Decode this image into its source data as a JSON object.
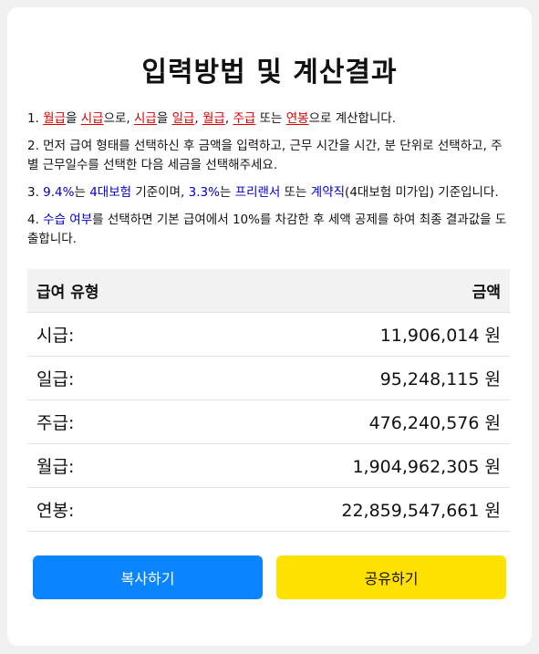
{
  "title": "입력방법 및 계산결과",
  "instructions": {
    "line1": {
      "num": "1. ",
      "t1": "월급",
      "s1": "을 ",
      "t2": "시급",
      "s2": "으로, ",
      "t3": "시급",
      "s3": "을 ",
      "t4": "일급",
      "s4": ", ",
      "t5": "월급",
      "s5": ", ",
      "t6": "주급",
      "s6": " 또는 ",
      "t7": "연봉",
      "s7": "으로 계산합니다."
    },
    "line2": "2. 먼저 급여 형태를 선택하신 후 금액을 입력하고, 근무 시간을 시간, 분 단위로 선택하고, 주별 근무일수를 선택한 다음 세금을 선택해주세요.",
    "line3": {
      "num": "3. ",
      "b1": "9.4%",
      "s1": "는 ",
      "b2": "4대보험",
      "s2": " 기준이며, ",
      "b3": "3.3%",
      "s3": "는 ",
      "b4": "프리랜서",
      "s4": " 또는 ",
      "b5": "계약직",
      "s5": "(4대보험 미가입) 기준입니다."
    },
    "line4": {
      "num": "4. ",
      "b1": "수습 여부",
      "s1": "를 선택하면 기본 급여에서 10%를 차감한 후 세액 공제를 하여 최종 결과값을 도출합니다."
    }
  },
  "table": {
    "header_type": "급여 유형",
    "header_amount": "금액",
    "rows": [
      {
        "label": "시급:",
        "amount": "11,906,014 원"
      },
      {
        "label": "일급:",
        "amount": "95,248,115 원"
      },
      {
        "label": "주급:",
        "amount": "476,240,576 원"
      },
      {
        "label": "월급:",
        "amount": "1,904,962,305 원"
      },
      {
        "label": "연봉:",
        "amount": "22,859,547,661 원"
      }
    ]
  },
  "buttons": {
    "copy": "복사하기",
    "share": "공유하기"
  },
  "colors": {
    "copy_button": "#0a84ff",
    "share_button": "#ffe100",
    "highlight_red": "#d40000",
    "highlight_blue": "#0000cc"
  }
}
